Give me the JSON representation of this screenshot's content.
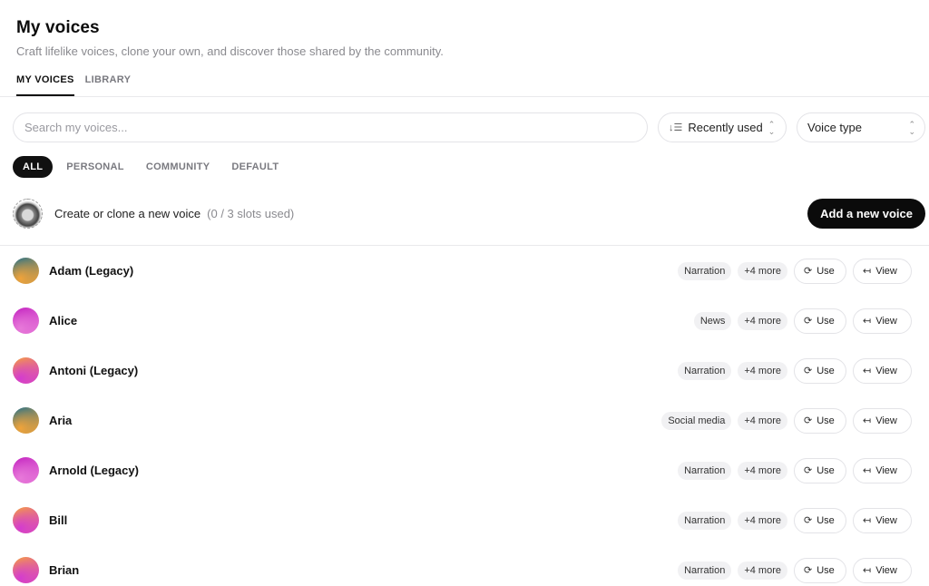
{
  "header": {
    "title": "My voices",
    "subtitle": "Craft lifelike voices, clone your own, and discover those shared by the community."
  },
  "tabs": [
    {
      "label": "MY VOICES",
      "active": true
    },
    {
      "label": "LIBRARY",
      "active": false
    }
  ],
  "search": {
    "placeholder": "Search my voices...",
    "value": ""
  },
  "sort": {
    "label": "Recently used"
  },
  "voice_type": {
    "label": "Voice type"
  },
  "filters": [
    {
      "label": "ALL",
      "active": true
    },
    {
      "label": "PERSONAL",
      "active": false
    },
    {
      "label": "COMMUNITY",
      "active": false
    },
    {
      "label": "DEFAULT",
      "active": false
    }
  ],
  "create": {
    "text": "Create or clone a new voice",
    "slots": "(0 / 3 slots used)",
    "button": "Add a new voice"
  },
  "buttons": {
    "use": "Use",
    "view": "View"
  },
  "voices": [
    {
      "name": "Adam (Legacy)",
      "tag": "Narration",
      "more": "+4 more",
      "gradient": [
        "#1f6f8b",
        "#f0a33a"
      ]
    },
    {
      "name": "Alice",
      "tag": "News",
      "more": "+4 more",
      "gradient": [
        "#c21fbf",
        "#e779d9"
      ]
    },
    {
      "name": "Antoni (Legacy)",
      "tag": "Narration",
      "more": "+4 more",
      "gradient": [
        "#f7a23b",
        "#d43ccf"
      ]
    },
    {
      "name": "Aria",
      "tag": "Social media",
      "more": "+4 more",
      "gradient": [
        "#1f6f8b",
        "#f0a33a"
      ]
    },
    {
      "name": "Arnold (Legacy)",
      "tag": "Narration",
      "more": "+4 more",
      "gradient": [
        "#c21fbf",
        "#e779d9"
      ]
    },
    {
      "name": "Bill",
      "tag": "Narration",
      "more": "+4 more",
      "gradient": [
        "#f7a23b",
        "#d43ccf"
      ]
    },
    {
      "name": "Brian",
      "tag": "Narration",
      "more": "+4 more",
      "gradient": [
        "#f7a23b",
        "#d43ccf"
      ]
    }
  ]
}
